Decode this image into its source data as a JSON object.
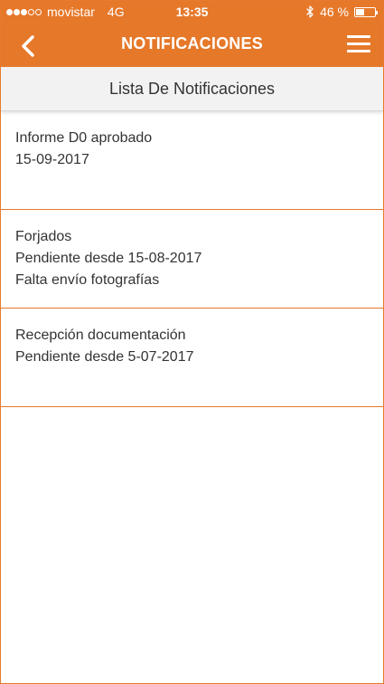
{
  "status_bar": {
    "carrier": "movistar",
    "network": "4G",
    "time": "13:35",
    "battery_text": "46 %",
    "battery_level": 0.46,
    "signal_bars_filled": 3,
    "signal_bars_total": 5
  },
  "header": {
    "title": "NOTIFICACIONES",
    "back_icon": "chevron-left-icon",
    "menu_icon": "hamburger-menu-icon"
  },
  "section": {
    "title": "Lista De Notificaciones"
  },
  "notifications": [
    {
      "lines": [
        "Informe D0 aprobado",
        "15-09-2017"
      ]
    },
    {
      "lines": [
        "Forjados",
        "Pendiente desde 15-08-2017",
        "Falta envío fotografías"
      ]
    },
    {
      "lines": [
        "Recepción documentación",
        "Pendiente desde 5-07-2017"
      ]
    }
  ],
  "colors": {
    "accent": "#e6782a",
    "text": "#333333",
    "header_bg": "#f2f2f2"
  }
}
